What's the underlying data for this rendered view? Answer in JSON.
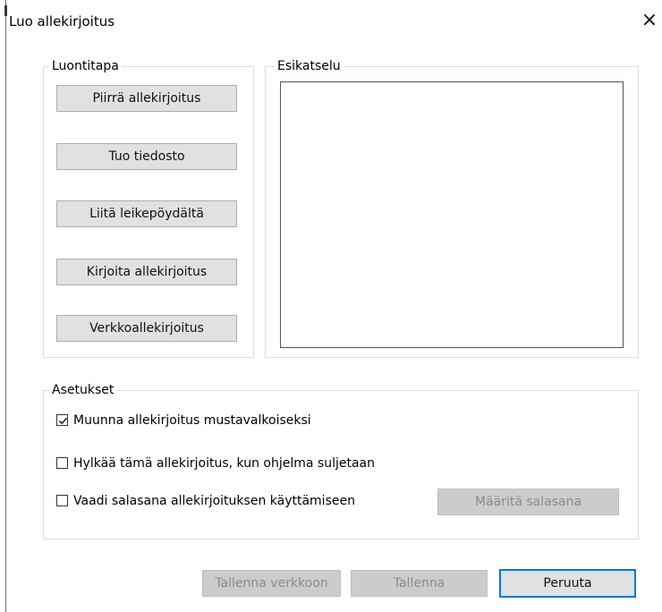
{
  "window": {
    "title": "Luo allekirjoitus",
    "close_symbol": "×"
  },
  "creation": {
    "legend": "Luontitapa",
    "buttons": [
      "Piirrä allekirjoitus",
      "Tuo tiedosto",
      "Liitä leikepöydältä",
      "Kirjoita allekirjoitus",
      "Verkkoallekirjoitus"
    ]
  },
  "preview": {
    "legend": "Esikatselu"
  },
  "settings": {
    "legend": "Asetukset",
    "options": [
      {
        "label": "Muunna allekirjoitus mustavalkoiseksi",
        "checked": true
      },
      {
        "label": "Hylkää tämä allekirjoitus, kun ohjelma suljetaan",
        "checked": false
      },
      {
        "label": "Vaadi salasana allekirjoituksen käyttämiseen",
        "checked": false
      }
    ],
    "set_password_label": "Määritä salasana"
  },
  "footer": {
    "save_online_label": "Tallenna verkkoon",
    "save_label": "Tallenna",
    "cancel_label": "Peruuta"
  },
  "colors": {
    "accent": "#0078d7",
    "button_bg": "#e1e1e1",
    "disabled_bg": "#cccccc",
    "disabled_text": "#8b8b8b"
  }
}
